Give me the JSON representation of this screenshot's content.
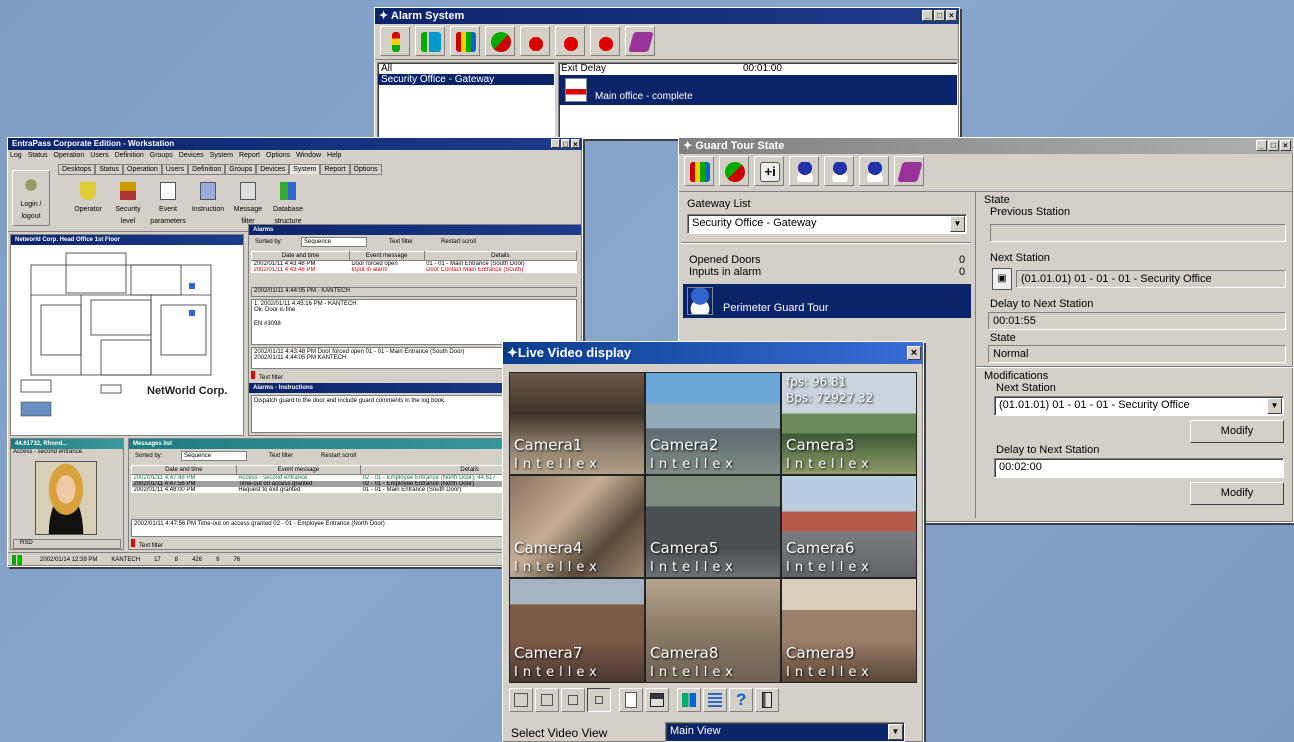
{
  "alarm_system": {
    "title": "Alarm System",
    "list_items": [
      "All",
      "Security Office - Gateway"
    ],
    "exit_delay_label": "Exit Delay",
    "exit_delay_value": "00:01:00",
    "entry_label": "Main office - complete"
  },
  "workstation": {
    "title": "EntraPass Corporate Edition - Workstation",
    "menu": [
      "Log",
      "Status",
      "Operation",
      "Users",
      "Definition",
      "Groups",
      "Devices",
      "System",
      "Report",
      "Options",
      "Window",
      "Help"
    ],
    "tabs": [
      "Desktops",
      "Status",
      "Operation",
      "Users",
      "Definition",
      "Groups",
      "Devices",
      "System",
      "Report",
      "Options"
    ],
    "toolbar": [
      "Login / logout",
      "Operator",
      "Security level",
      "Event parameters",
      "Instruction",
      "Message filter",
      "Database structure"
    ],
    "floor_title": "Networld Corp. Head Office 1st Floor",
    "floor_brand": "NetWorld Corp.",
    "alarms": {
      "title": "Alarms",
      "sorted_by_label": "Sorted by:",
      "sorted_by_value": "Sequence",
      "text_filter": "Text filter",
      "restart_scroll": "Restart scroll",
      "columns": [
        "Date and time",
        "Event message",
        "Details"
      ],
      "rows": [
        {
          "date": "2002/01/11 4:43:48 PM",
          "event": "Door forced open",
          "details": "01 - 01 - Main Entrance (South Door)"
        },
        {
          "date": "2002/01/11 4:43:48 PM",
          "event": "Input in alarm",
          "details": "Door Contact Main Entrance (South)"
        }
      ],
      "selected": "2002/01/11 4:44:05 PM - KANTECH",
      "note1": "1. 2002/01/11 4:45:16 PM - KANTECH",
      "note2": "Ok. Door is fine",
      "note3": "EN #3098",
      "summary1": "2002/01/11 4:43:48 PM  Door forced open  01 - 01 - Main Entrance (South Door)",
      "summary2": "2002/01/11 4:44:05 PM  KANTECH"
    },
    "instructions": {
      "title": "Alarms - Instructions",
      "text": "Dispatch guard to the door and include guard comments in the log book."
    },
    "card_title": "44.61732, Rhond...",
    "card_access": "Access - second entrance",
    "card_footer": "RSD",
    "messages": {
      "title": "Messages list",
      "sorted_by_label": "Sorted by:",
      "sorted_by_value": "Sequence",
      "text_filter": "Text filter",
      "restart_scroll": "Restart scroll",
      "columns": [
        "Date and time",
        "Event message",
        "Details"
      ],
      "rows": [
        {
          "date": "2002/01/11 4:47:48 PM",
          "event": "Access - second entrance",
          "details": "02 - 01 - Employee Entrance (North Door), 44.617"
        },
        {
          "date": "2002/01/11 4:47:56 PM",
          "event": "Time-out on access granted",
          "details": "02 - 01 - Employee Entrance (North Door)"
        },
        {
          "date": "2002/01/11 4:48:00 PM",
          "event": "Request to exit granted",
          "details": "01 - 01 - Main Entrance (South Door)"
        }
      ],
      "summary": "2002/01/11 4:47:56 PM  Time-out on access granted  02 - 01 - Employee Entrance (North Door)"
    },
    "status_bar": [
      "2002/01/14 12:39 PM",
      "KANTECH",
      "17",
      "8",
      "426",
      "9",
      "76"
    ]
  },
  "guard_tour": {
    "title": "Guard Tour State",
    "gateway_label": "Gateway List",
    "gateway_value": "Security Office - Gateway",
    "opened_doors_label": "Opened Doors",
    "opened_doors_value": "0",
    "inputs_label": "Inputs in alarm",
    "inputs_value": "0",
    "tour_item": "Perimeter Guard Tour",
    "state_group": "State",
    "previous_station_label": "Previous Station",
    "next_station_label": "Next Station",
    "next_station_value": "(01.01.01) 01 - 01 - 01 - Security Office",
    "delay_label": "Delay to Next Station",
    "delay_value": "00:01:55",
    "state_label": "State",
    "state_value": "Normal",
    "modifications_label": "Modifications",
    "mod_next_station_label": "Next Station",
    "mod_next_station_value": "(01.01.01) 01 - 01 - 01 - Security Office",
    "modify_label": "Modify",
    "mod_delay_label": "Delay to Next Station",
    "mod_delay_value": "00:02:00"
  },
  "video": {
    "title": "Live Video display",
    "fps_label": "fps:",
    "fps_value": "96.81",
    "bps_label": "Bps:",
    "bps_value": "72927.32",
    "cameras": [
      "Camera1",
      "Camera2",
      "Camera3",
      "Camera4",
      "Camera5",
      "Camera6",
      "Camera7",
      "Camera8",
      "Camera9"
    ],
    "brand": "Intellex",
    "select_label": "Select Video View",
    "select_value": "Main View"
  },
  "colors": {
    "desktop": "#809fc6",
    "titlebar": "#0a246a",
    "window": "#d4d0c8",
    "alarm_red": "#d40000"
  },
  "icons": [
    "bar-chart-icon",
    "guard-icon",
    "siren-icon",
    "help-book-icon",
    "close-icon"
  ]
}
